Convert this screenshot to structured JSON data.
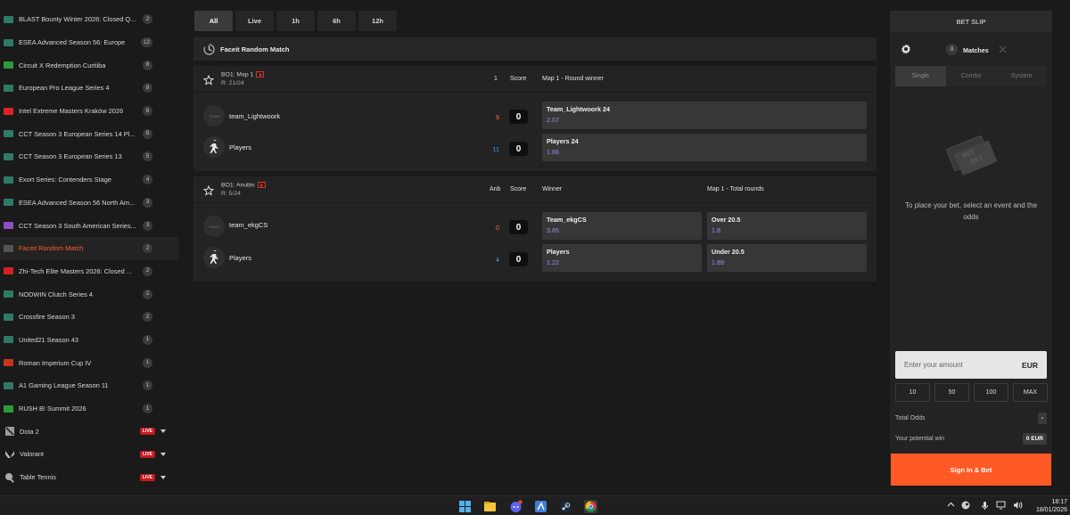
{
  "sidebar": {
    "items": [
      {
        "label": "BLAST Bounty Winter 2026: Closed Q...",
        "count": "2",
        "flag": "#2f7a66"
      },
      {
        "label": "ESEA Advanced Season 56: Europe",
        "count": "12",
        "flag": "#2f7a66"
      },
      {
        "label": "Circuit X Redemption Curitiba",
        "count": "8",
        "flag": "#2d9a3a"
      },
      {
        "label": "European Pro League Series 4",
        "count": "8",
        "flag": "#2f7a66"
      },
      {
        "label": "Intel Extreme Masters Kraków 2026",
        "count": "8",
        "flag": "#dd2222"
      },
      {
        "label": "CCT Season 3 European Series 14 Pl...",
        "count": "8",
        "flag": "#2f7a66"
      },
      {
        "label": "CCT Season 3 European Series 13",
        "count": "5",
        "flag": "#2f7a66"
      },
      {
        "label": "Exort Series: Contenders Stage",
        "count": "4",
        "flag": "#2f7a66"
      },
      {
        "label": "ESEA Advanced Season 56 North Am...",
        "count": "3",
        "flag": "#2f7a66"
      },
      {
        "label": "CCT Season 3 South American Series...",
        "count": "3",
        "flag": "#8a4fc0"
      },
      {
        "label": "Faceit Random Match",
        "count": "2",
        "flag": "#555555",
        "active": true
      },
      {
        "label": "Zhi-Tech Elite Masters 2026: Closed ...",
        "count": "2",
        "flag": "#d62020"
      },
      {
        "label": "NODWIN Clutch Series 4",
        "count": "2",
        "flag": "#2f7a66"
      },
      {
        "label": "Crossfire Season 3",
        "count": "2",
        "flag": "#2f7a66"
      },
      {
        "label": "United21 Season 43",
        "count": "1",
        "flag": "#2f7a66"
      },
      {
        "label": "Roman Imperium Cup IV",
        "count": "1",
        "flag": "#c8341c"
      },
      {
        "label": "A1 Gaming League Season 11",
        "count": "1",
        "flag": "#2f7a66"
      },
      {
        "label": "RUSH B! Summit 2026",
        "count": "1",
        "flag": "#2d9a3a"
      }
    ],
    "games": [
      {
        "label": "Dota 2",
        "badge": "LIVE",
        "icon": "dota-icon"
      },
      {
        "label": "Valorant",
        "badge": "LIVE",
        "icon": "valorant-icon"
      },
      {
        "label": "Table Tennis",
        "badge": "LIVE",
        "icon": "table-tennis-icon"
      }
    ]
  },
  "filters": [
    "All",
    "Live",
    "1h",
    "6h",
    "12h"
  ],
  "section": {
    "title": "Faceit Random Match"
  },
  "matches": [
    {
      "bo": "BO1: Map 1",
      "round": "R: 21/24",
      "col1": "1",
      "score_label": "Score",
      "market1": "Map 1 - Round winner",
      "market2": "",
      "teams": [
        {
          "name": "team_Lightwoork",
          "rounds": "9",
          "rounds_color": "#ff6b2e",
          "score": "0"
        },
        {
          "name": "Players",
          "rounds": "11",
          "rounds_color": "#2fa8e0",
          "score": "0"
        }
      ],
      "odds1": [
        {
          "name": "Team_Lightwoork 24",
          "value": "2.07"
        },
        {
          "name": "Players 24",
          "value": "1.66"
        }
      ],
      "odds2": []
    },
    {
      "bo": "BO1: Anubis",
      "round": "R: 5/24",
      "col1": "Anb",
      "score_label": "Score",
      "market1": "Winner",
      "market2": "Map 1 - Total rounds",
      "teams": [
        {
          "name": "team_ekgCS",
          "rounds": "0",
          "rounds_color": "#ff6b2e",
          "score": "0"
        },
        {
          "name": "Players",
          "rounds": "4",
          "rounds_color": "#2fa8e0",
          "score": "0"
        }
      ],
      "odds1": [
        {
          "name": "Team_ekgCS",
          "value": "3.85"
        },
        {
          "name": "Players",
          "value": "1.22"
        }
      ],
      "odds2": [
        {
          "name": "Over 20.5",
          "value": "1.8"
        },
        {
          "name": "Under 20.5",
          "value": "1.89"
        }
      ]
    }
  ],
  "betslip": {
    "title": "BET SLIP",
    "matches_count": "0",
    "matches_label": "Matches",
    "tabs": [
      "Single",
      "Combo",
      "System"
    ],
    "message": "To place your bet, select an event and the odds",
    "amount_placeholder": "Enter your amount",
    "currency": "EUR",
    "quick": [
      "10",
      "50",
      "100",
      "MAX"
    ],
    "total_odds_label": "Total Odds",
    "total_odds_value": "-",
    "potential_label": "Your potential win",
    "potential_value": "0 EUR",
    "cta": "Sign In & Bet"
  },
  "taskbar": {
    "time": "18:17",
    "date": "18/01/2026",
    "apps": [
      "windows-start-icon",
      "file-explorer-icon",
      "discord-icon",
      "app-icon",
      "steam-icon",
      "chrome-icon"
    ]
  }
}
